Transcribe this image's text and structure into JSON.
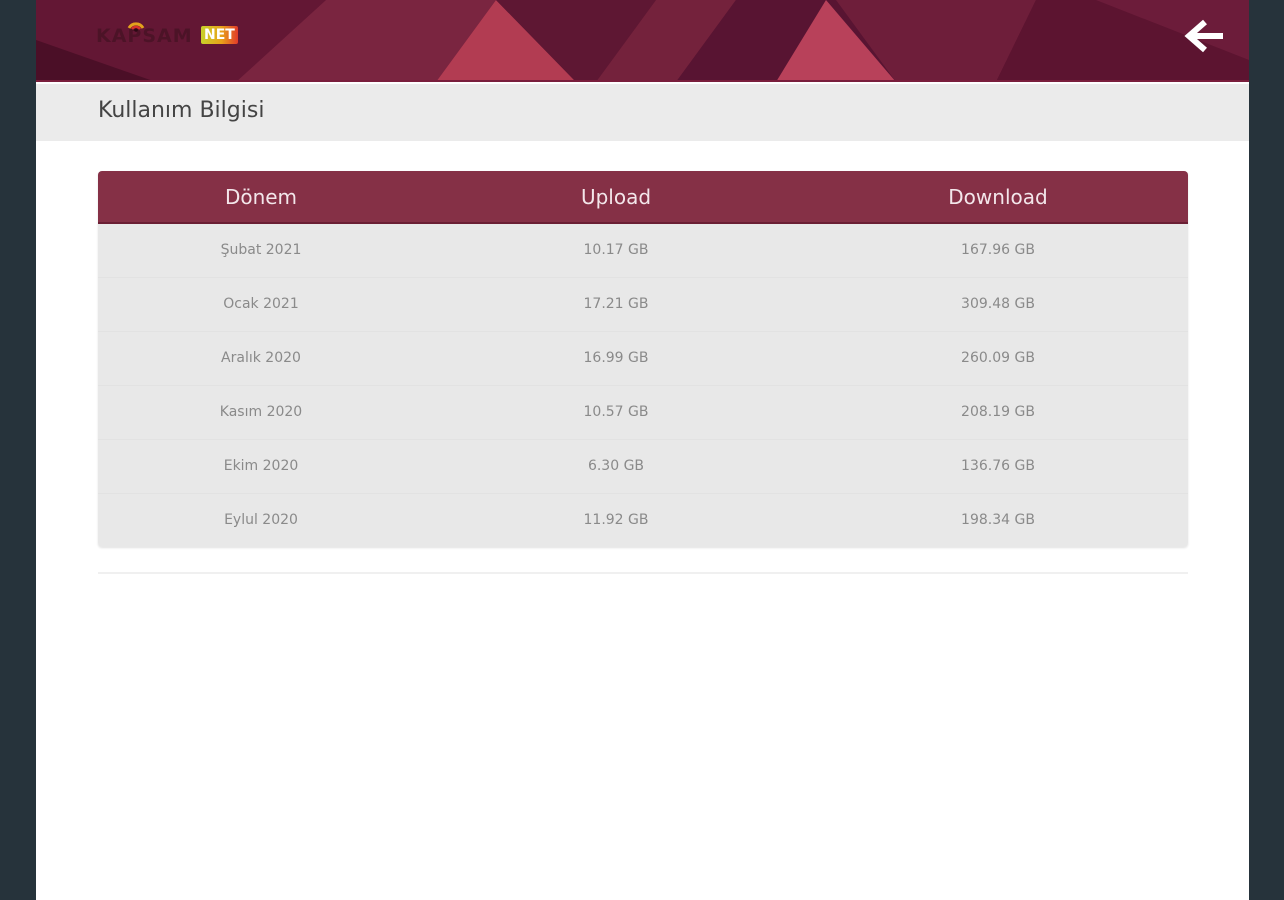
{
  "header": {
    "logo_text": "KAPSAM",
    "logo_suffix": "NET",
    "back_icon": "arrow-left-icon",
    "colors": {
      "header_bg": "#5c1530",
      "accent": "#853046"
    }
  },
  "page": {
    "title": "Kullanım Bilgisi"
  },
  "usage_table": {
    "columns": [
      "Dönem",
      "Upload",
      "Download"
    ],
    "rows": [
      {
        "period": "Şubat 2021",
        "upload": "10.17 GB",
        "download": "167.96 GB"
      },
      {
        "period": "Ocak 2021",
        "upload": "17.21 GB",
        "download": "309.48 GB"
      },
      {
        "period": "Aralık 2020",
        "upload": "16.99 GB",
        "download": "260.09 GB"
      },
      {
        "period": "Kasım 2020",
        "upload": "10.57 GB",
        "download": "208.19 GB"
      },
      {
        "period": "Ekim 2020",
        "upload": "6.30 GB",
        "download": "136.76 GB"
      },
      {
        "period": "Eylul 2020",
        "upload": "11.92 GB",
        "download": "198.34 GB"
      }
    ]
  }
}
